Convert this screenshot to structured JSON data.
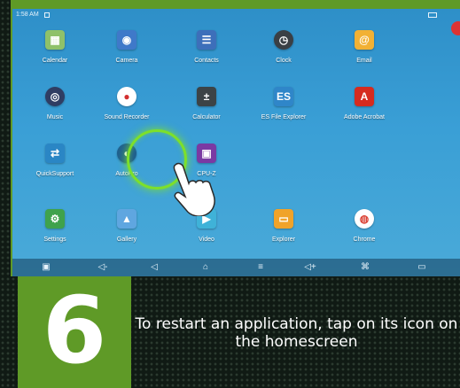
{
  "status_bar": {
    "time": "1:58 AM"
  },
  "apps": [
    {
      "id": "calendar",
      "label": "Calendar",
      "icon": "calendar-icon",
      "color": "#8fc16a",
      "glyph": "▦"
    },
    {
      "id": "camera",
      "label": "Camera",
      "icon": "camera-icon",
      "color": "#3f79c9",
      "glyph": "◉"
    },
    {
      "id": "contacts",
      "label": "Contacts",
      "icon": "contacts-icon",
      "color": "#3d6fba",
      "glyph": "☰"
    },
    {
      "id": "clock",
      "label": "Clock",
      "icon": "clock-icon",
      "color": "#3a3f45",
      "glyph": "◷"
    },
    {
      "id": "email",
      "label": "Email",
      "icon": "email-icon",
      "color": "#f2b134",
      "glyph": "@"
    },
    {
      "id": "music",
      "label": "Music",
      "icon": "music-icon",
      "color": "#2f3d63",
      "glyph": "◎"
    },
    {
      "id": "sound-recorder",
      "label": "Sound Recorder",
      "icon": "microphone-icon",
      "color": "#ffffff",
      "glyph": "●"
    },
    {
      "id": "calculator",
      "label": "Calculator",
      "icon": "calculator-icon",
      "color": "#3c4346",
      "glyph": "±"
    },
    {
      "id": "es-file-explorer",
      "label": "ES File Explorer",
      "icon": "folder-cloud-icon",
      "color": "#2f86c9",
      "glyph": "ES"
    },
    {
      "id": "adobe-acrobat",
      "label": "Adobe Acrobat",
      "icon": "pdf-icon",
      "color": "#d62b1f",
      "glyph": "A"
    },
    {
      "id": "quicksupport",
      "label": "QuickSupport",
      "icon": "quicksupport-icon",
      "color": "#2a86c5",
      "glyph": "⇄"
    },
    {
      "id": "autopro",
      "label": "AutoPro",
      "icon": "autopro-icon",
      "color": "#1f5f8f",
      "glyph": "◐"
    },
    {
      "id": "cpu-z",
      "label": "CPU-Z",
      "icon": "cpu-icon",
      "color": "#7a3aa3",
      "glyph": "▣"
    },
    {
      "id": "settings",
      "label": "Settings",
      "icon": "gear-icon",
      "color": "#3fa24c",
      "glyph": "⚙"
    },
    {
      "id": "gallery",
      "label": "Gallery",
      "icon": "gallery-icon",
      "color": "#5fa6e0",
      "glyph": "▲"
    },
    {
      "id": "video",
      "label": "Video",
      "icon": "video-icon",
      "color": "#3fb2d8",
      "glyph": "▶"
    },
    {
      "id": "explorer",
      "label": "Explorer",
      "icon": "folder-icon",
      "color": "#f0a32a",
      "glyph": "▭"
    },
    {
      "id": "chrome",
      "label": "Chrome",
      "icon": "chrome-icon",
      "color": "#ffffff",
      "glyph": "◍"
    }
  ],
  "navbar": [
    {
      "id": "screenshot",
      "icon": "screenshot-icon",
      "glyph": "▣"
    },
    {
      "id": "volume-down",
      "icon": "volume-down-icon",
      "glyph": "◁-"
    },
    {
      "id": "back",
      "icon": "back-icon",
      "glyph": "◁"
    },
    {
      "id": "home",
      "icon": "home-icon",
      "glyph": "⌂"
    },
    {
      "id": "menu",
      "icon": "menu-icon",
      "glyph": "≡"
    },
    {
      "id": "volume-up",
      "icon": "volume-up-icon",
      "glyph": "◁+"
    },
    {
      "id": "gamepad",
      "icon": "gamepad-icon",
      "glyph": "⌘"
    },
    {
      "id": "recent",
      "icon": "recent-apps-icon",
      "glyph": "▭"
    }
  ],
  "step": {
    "number": "6",
    "instruction": "To restart an application, tap on its icon on the homescreen"
  },
  "colors": {
    "accent_green": "#5f9a27",
    "highlight_green": "#7de02a",
    "screen_blue": "#3a9fd6"
  }
}
